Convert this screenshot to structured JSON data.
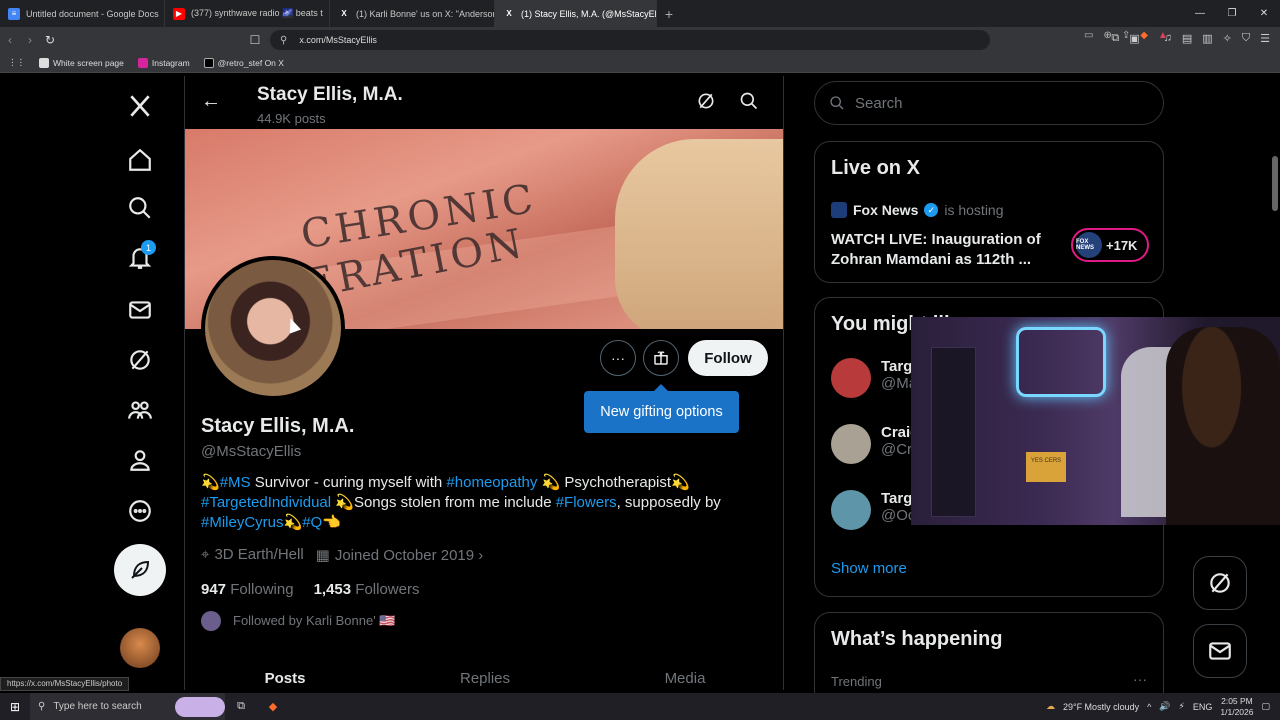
{
  "browser": {
    "tabs": [
      {
        "title": "Untitled document - Google Docs",
        "color": "#4285f4",
        "glyph": "≡"
      },
      {
        "title": "(377) synthwave radio 🌌 beats t",
        "color": "#ff0000",
        "glyph": "▶"
      },
      {
        "title": "(1) Karli Bonne' us on X: \"Anderson C",
        "color": "#000000",
        "glyph": "X"
      },
      {
        "title": "(1) Stacy Ellis, M.A. (@MsStacyEl",
        "color": "#000000",
        "glyph": "X"
      }
    ],
    "url": "x.com/MsStacyEllis",
    "bookmarks": [
      "White screen page",
      "Instagram",
      "@retro_stef On X"
    ],
    "status_url": "https://x.com/MsStacyEllis/photo"
  },
  "nav": {
    "notification_count": "1"
  },
  "header": {
    "name": "Stacy Ellis, M.A.",
    "posts": "44.9K posts"
  },
  "banner": {
    "line1": "CHRONIC",
    "line2": "LIBERATION"
  },
  "profile": {
    "name": "Stacy Ellis, M.A.",
    "handle": "@MsStacyEllis",
    "bio": {
      "p1": "💫",
      "l1": "#MS",
      "p2": " Survivor - curing myself with ",
      "l2": "#homeopathy",
      "p3": " 💫 Psychotherapist💫 ",
      "l3": "#TargetedIndividual",
      "p4": " 💫Songs stolen from me include ",
      "l4": "#Flowers",
      "p5": ", supposedly by ",
      "l5": "#MileyCyrus",
      "p6": "💫",
      "l6": "#Q",
      "p7": "👈"
    },
    "location": "3D Earth/Hell",
    "joined": "Joined October 2019",
    "following_count": "947",
    "following_label": "Following",
    "followers_count": "1,453",
    "followers_label": "Followers",
    "followed_by": "Followed by Karli Bonne' 🇺🇸",
    "follow_label": "Follow",
    "tooltip": "New gifting options",
    "tabs": [
      "Posts",
      "Replies",
      "Media"
    ]
  },
  "sidebar": {
    "search_placeholder": "Search",
    "live": {
      "heading": "Live on X",
      "host": "Fox News",
      "hosting": "is hosting",
      "title": "WATCH LIVE: Inauguration of Zohran Mamdani as 112th ...",
      "count": "+17K",
      "logo": "FOX NEWS"
    },
    "suggest": {
      "heading": "You might like",
      "items": [
        {
          "name": "Targ",
          "handle": "@Ma"
        },
        {
          "name": "Craig",
          "handle": "@Cra"
        },
        {
          "name": "Targ",
          "handle": "@OccupyCorlCA"
        }
      ],
      "show_more": "Show more"
    },
    "happening": {
      "heading": "What’s happening",
      "sub": "Trending"
    }
  },
  "webcam": {
    "sign": "YES CERS"
  },
  "taskbar": {
    "search": "Type here to search",
    "weather": "29°F  Mostly cloudy",
    "time": "2:05 PM",
    "date": "1/1/2026"
  }
}
